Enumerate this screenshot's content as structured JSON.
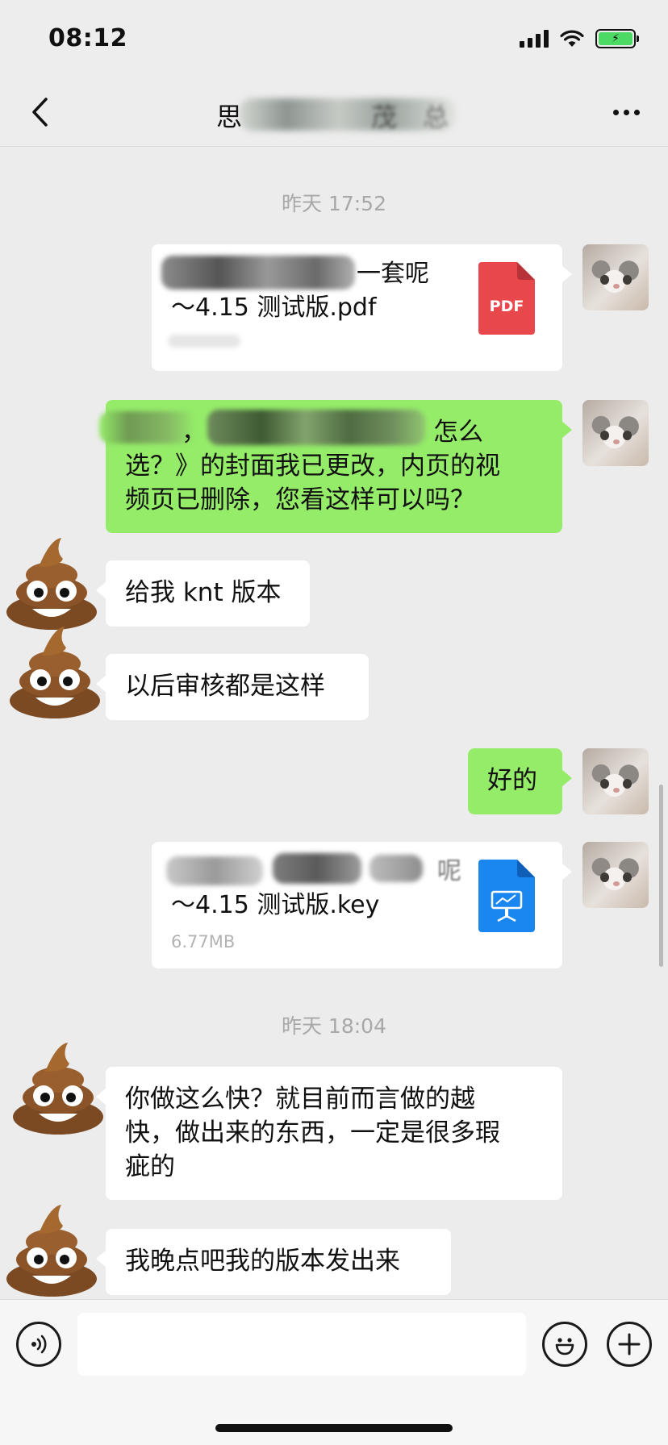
{
  "status_bar": {
    "time": "08:12",
    "battery_color": "#4cd964"
  },
  "nav": {
    "back_icon": "chevron-left-icon",
    "title_prefix": "思",
    "title_fragment_1": "茂",
    "title_fragment_2": "总",
    "more_icon": "more-horizontal-icon"
  },
  "messages": {
    "ts1": "昨天 17:52",
    "file1": {
      "name_tail": "一套呢",
      "name_line2": "～4.15 测试版.pdf",
      "icon_label": "PDF",
      "icon_color": "#e8474c"
    },
    "msg1": {
      "fragment_start": "，",
      "fragment_mid": "怎么",
      "line2": "选？》的封面我已更改，内页的视",
      "line3": "频页已删除，您看这样可以吗？"
    },
    "msg2": "给我 knt 版本",
    "msg3": "以后审核都是这样",
    "msg4": "好的",
    "file2": {
      "name_tail": "呢",
      "name_line2": "～4.15 测试版.key",
      "size": "6.77MB",
      "icon_color": "#1a86f0"
    },
    "ts2": "昨天 18:04",
    "msg5": {
      "line1": "你做这么快？就目前而言做的越",
      "line2": "快，做出来的东西，一定是很多瑕",
      "line3": "疵的"
    },
    "msg6": "我晚点吧我的版本发出来"
  },
  "input_bar": {
    "voice_icon": "voice-icon",
    "emoji_icon": "emoji-icon",
    "plus_icon": "plus-icon",
    "placeholder": ""
  },
  "colors": {
    "own_bubble": "#95ec69",
    "other_bubble": "#ffffff",
    "background": "#ececec"
  }
}
